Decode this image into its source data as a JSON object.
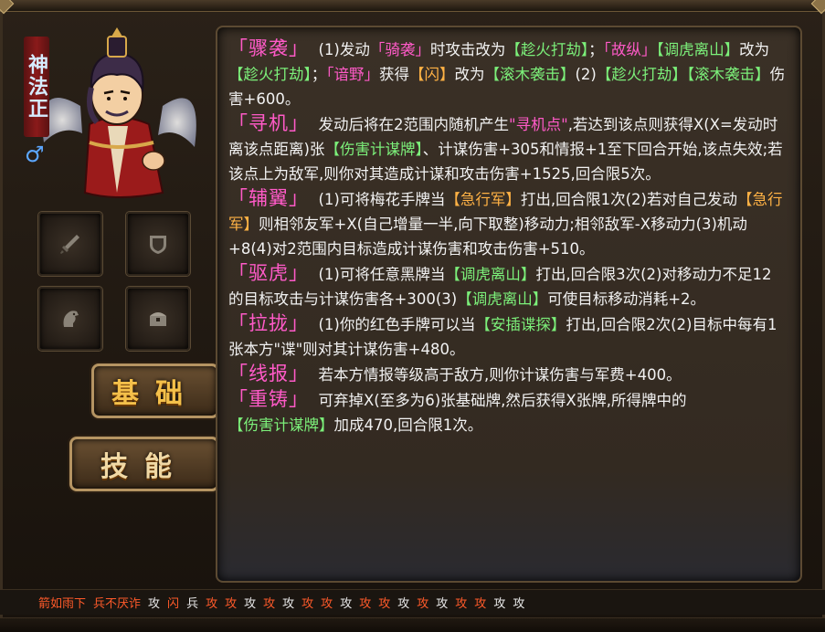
{
  "character": {
    "name": "神法正",
    "gender_symbol": "♂"
  },
  "equipment_slots": [
    {
      "icon": "sword-icon"
    },
    {
      "icon": "shield-icon"
    },
    {
      "icon": "horse-icon"
    },
    {
      "icon": "treasure-icon"
    }
  ],
  "tabs": {
    "basic": "基础",
    "skills": "技能"
  },
  "skills": [
    {
      "name": "骤袭",
      "desc": [
        {
          "t": "(1)发动",
          "c": ""
        },
        {
          "t": "「骑袭」",
          "c": "pink"
        },
        {
          "t": "时攻击改为",
          "c": ""
        },
        {
          "t": "【趁火打劫】",
          "c": "green"
        },
        {
          "t": "；",
          "c": ""
        },
        {
          "t": "「故纵」",
          "c": "pink"
        },
        {
          "t": "【调虎离山】",
          "c": "green"
        },
        {
          "t": "改为",
          "c": ""
        },
        {
          "t": "【趁火打劫】",
          "c": "green"
        },
        {
          "t": "；",
          "c": ""
        },
        {
          "t": "「谙野」",
          "c": "pink"
        },
        {
          "t": "获得",
          "c": ""
        },
        {
          "t": "【闪】",
          "c": "orange"
        },
        {
          "t": "改为",
          "c": ""
        },
        {
          "t": "【滚木袭击】",
          "c": "green"
        },
        {
          "t": "(2)",
          "c": ""
        },
        {
          "t": "【趁火打劫】",
          "c": "green"
        },
        {
          "t": "【滚木袭击】",
          "c": "green"
        },
        {
          "t": "伤害+600。",
          "c": ""
        }
      ]
    },
    {
      "name": "寻机",
      "desc": [
        {
          "t": "发动后将在2范围内随机产生",
          "c": ""
        },
        {
          "t": "\"寻机点\"",
          "c": "pink"
        },
        {
          "t": ",若达到该点则获得X(X=发动时离该点距离)张",
          "c": ""
        },
        {
          "t": "【伤害计谋牌】",
          "c": "green"
        },
        {
          "t": "、计谋伤害+305和情报+1至下回合开始,该点失效;若该点上为敌军,则你对其造成计谋和攻击伤害+1525,回合限5次。",
          "c": ""
        }
      ]
    },
    {
      "name": "辅翼",
      "desc": [
        {
          "t": "(1)可将梅花手牌当",
          "c": ""
        },
        {
          "t": "【急行军】",
          "c": "orange"
        },
        {
          "t": "打出,回合限1次(2)若对自己发动",
          "c": ""
        },
        {
          "t": "【急行军】",
          "c": "orange"
        },
        {
          "t": "则相邻友军+X(自己增量一半,向下取整)移动力;相邻敌军-X移动力(3)机动+8(4)对2范围内目标造成计谋伤害和攻击伤害+510。",
          "c": ""
        }
      ]
    },
    {
      "name": "驱虎",
      "desc": [
        {
          "t": "(1)可将任意黑牌当",
          "c": ""
        },
        {
          "t": "【调虎离山】",
          "c": "green"
        },
        {
          "t": "打出,回合限3次(2)对移动力不足12的目标攻击与计谋伤害各+300(3)",
          "c": ""
        },
        {
          "t": "【调虎离山】",
          "c": "green"
        },
        {
          "t": "可使目标移动消耗+2。",
          "c": ""
        }
      ]
    },
    {
      "name": "拉拢",
      "desc": [
        {
          "t": "(1)你的红色手牌可以当",
          "c": ""
        },
        {
          "t": "【安插谍探】",
          "c": "green"
        },
        {
          "t": "打出,回合限2次(2)目标中每有1张本方\"谍\"则对其计谋伤害+480。",
          "c": ""
        }
      ]
    },
    {
      "name": "线报",
      "desc": [
        {
          "t": "若本方情报等级高于敌方,则你计谋伤害与军费+400。",
          "c": ""
        }
      ]
    },
    {
      "name": "重铸",
      "desc": [
        {
          "t": "可弃掉X(至多为6)张基础牌,然后获得X张牌,所得牌中的",
          "c": ""
        },
        {
          "t": "【伤害计谋牌】",
          "c": "green"
        },
        {
          "t": "加成470,回合限1次。",
          "c": ""
        }
      ]
    }
  ],
  "card_bar": [
    {
      "t": "箭如雨下",
      "c": "red"
    },
    {
      "t": "兵不厌诈",
      "c": "red"
    },
    {
      "t": "攻",
      "c": "white"
    },
    {
      "t": "闪",
      "c": "red"
    },
    {
      "t": "兵",
      "c": "white"
    },
    {
      "t": "攻",
      "c": "red"
    },
    {
      "t": "攻",
      "c": "red"
    },
    {
      "t": "攻",
      "c": "white"
    },
    {
      "t": "攻",
      "c": "red"
    },
    {
      "t": "攻",
      "c": "white"
    },
    {
      "t": "攻",
      "c": "red"
    },
    {
      "t": "攻",
      "c": "red"
    },
    {
      "t": "攻",
      "c": "white"
    },
    {
      "t": "攻",
      "c": "red"
    },
    {
      "t": "攻",
      "c": "red"
    },
    {
      "t": "攻",
      "c": "white"
    },
    {
      "t": "攻",
      "c": "red"
    },
    {
      "t": "攻",
      "c": "white"
    },
    {
      "t": "攻",
      "c": "red"
    },
    {
      "t": "攻",
      "c": "red"
    },
    {
      "t": "攻",
      "c": "white"
    },
    {
      "t": "攻",
      "c": "white"
    }
  ]
}
